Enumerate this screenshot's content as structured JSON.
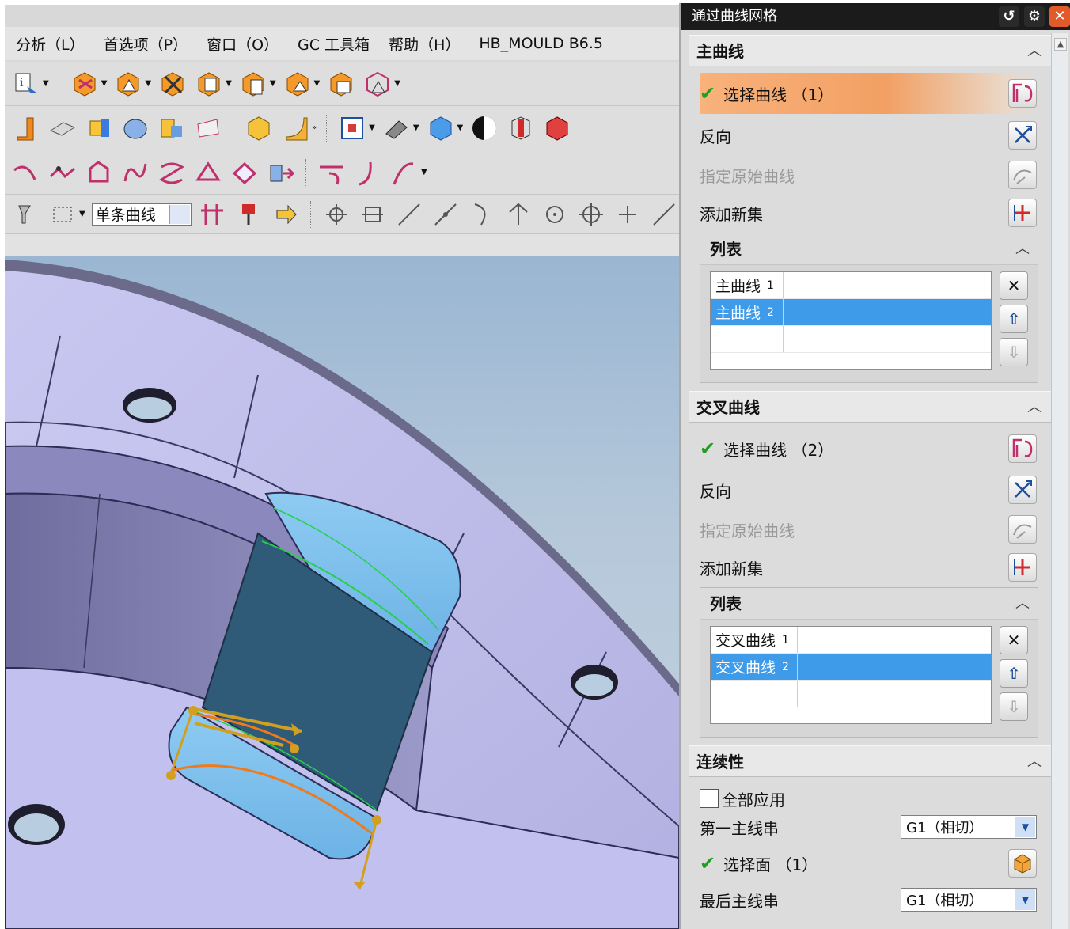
{
  "menubar": {
    "items": [
      "分析（L）",
      "首选项（P）",
      "窗口（O）",
      "GC 工具箱",
      "帮助（H）",
      "HB_MOULD B6.5"
    ]
  },
  "toolbar": {
    "filter_value": "单条曲线"
  },
  "dialog": {
    "title": "通过曲线网格",
    "primary": {
      "header": "主曲线",
      "select_curve": "选择曲线 （1）",
      "reverse": "反向",
      "specify_origin": "指定原始曲线",
      "add_new_set": "添加新集",
      "list_header": "列表",
      "list_items": [
        {
          "name": "主曲线",
          "index": "1"
        },
        {
          "name": "主曲线",
          "index": "2"
        }
      ]
    },
    "cross": {
      "header": "交叉曲线",
      "select_curve": "选择曲线 （2）",
      "reverse": "反向",
      "specify_origin": "指定原始曲线",
      "add_new_set": "添加新集",
      "list_header": "列表",
      "list_items": [
        {
          "name": "交叉曲线",
          "index": "1"
        },
        {
          "name": "交叉曲线",
          "index": "2"
        }
      ]
    },
    "continuity": {
      "header": "连续性",
      "apply_all": "全部应用",
      "first_primary": "第一主线串",
      "first_primary_value": "G1（相切）",
      "select_face": "选择面 （1）",
      "last_primary": "最后主线串",
      "last_primary_value": "G1（相切）"
    }
  },
  "colors": {
    "title_bar": "#1b1b1b",
    "active_row": "#f2a064",
    "list_selection": "#3d9be9",
    "check": "#1fa01f",
    "close_button": "#e05a2a"
  }
}
